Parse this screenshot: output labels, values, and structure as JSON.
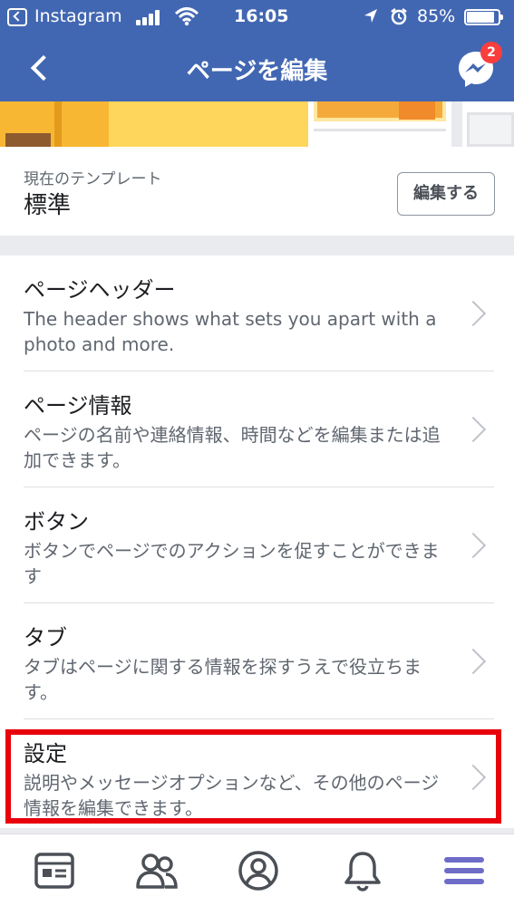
{
  "status_bar": {
    "back_app": "Instagram",
    "time": "16:05",
    "battery": "85%"
  },
  "nav": {
    "title": "ページを編集",
    "messenger_badge": "2",
    "icons": [
      "back-chevron-icon",
      "messenger-icon"
    ]
  },
  "template": {
    "label": "現在のテンプレート",
    "value": "標準",
    "edit_button": "編集する"
  },
  "menu": {
    "items": [
      {
        "title": "ページヘッダー",
        "description": "The header shows what sets you apart with a photo and more."
      },
      {
        "title": "ページ情報",
        "description": "ページの名前や連絡情報、時間などを編集または追加できます。"
      },
      {
        "title": "ボタン",
        "description": "ボタンでページでのアクションを促すことができます"
      },
      {
        "title": "タブ",
        "description": "タブはページに関する情報を探すうえで役立ちます。"
      },
      {
        "title": "設定",
        "description": "説明やメッセージオプションなど、その他のページ情報を編集できます。"
      }
    ]
  },
  "tab_bar": {
    "tabs": [
      "news-feed-icon",
      "friends-icon",
      "profile-icon",
      "notifications-icon",
      "menu-icon"
    ],
    "active_tab": "menu-icon"
  },
  "colors": {
    "brand_blue": "#4267b2",
    "highlight_red": "#e8000c",
    "badge_red": "#fa3e3e",
    "active_tab_purple": "#6f6cc8",
    "inactive_icon": "#4b4f56"
  }
}
